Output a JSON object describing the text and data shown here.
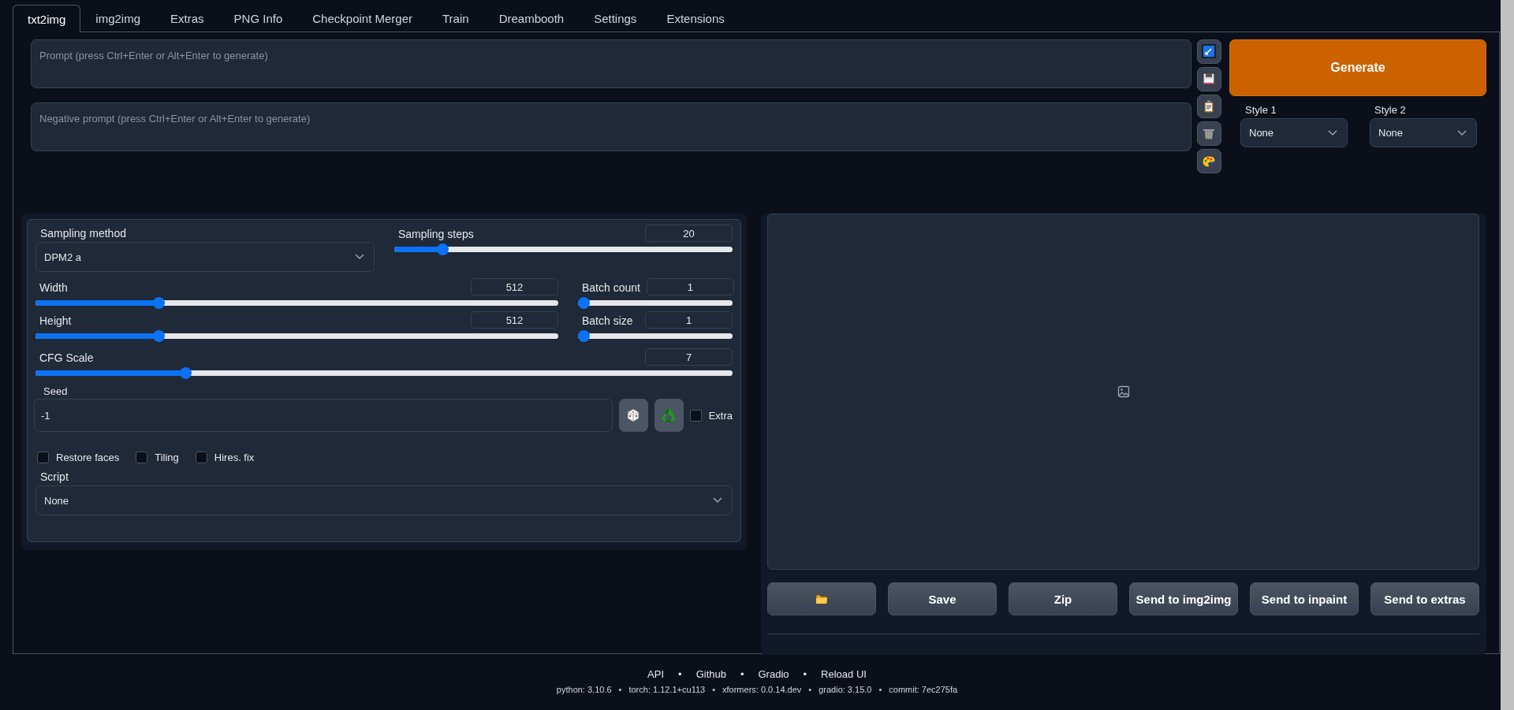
{
  "tabs": [
    {
      "label": "txt2img",
      "selected": true
    },
    {
      "label": "img2img",
      "selected": false
    },
    {
      "label": "Extras",
      "selected": false
    },
    {
      "label": "PNG Info",
      "selected": false
    },
    {
      "label": "Checkpoint Merger",
      "selected": false
    },
    {
      "label": "Train",
      "selected": false
    },
    {
      "label": "Dreambooth",
      "selected": false
    },
    {
      "label": "Settings",
      "selected": false
    },
    {
      "label": "Extensions",
      "selected": false
    }
  ],
  "prompt": {
    "placeholder": "Prompt (press Ctrl+Enter or Alt+Enter to generate)"
  },
  "negative_prompt": {
    "placeholder": "Negative prompt (press Ctrl+Enter or Alt+Enter to generate)"
  },
  "generate_button": "Generate",
  "styles": [
    {
      "label": "Style 1",
      "value": "None"
    },
    {
      "label": "Style 2",
      "value": "None"
    }
  ],
  "sampling_method": {
    "label": "Sampling method",
    "value": "DPM2 a"
  },
  "sampling_steps": {
    "label": "Sampling steps",
    "value": "20",
    "level": 0.13
  },
  "width": {
    "label": "Width",
    "value": "512",
    "level": 0.23
  },
  "batch_count": {
    "label": "Batch count",
    "value": "1",
    "level": 0
  },
  "height": {
    "label": "Height",
    "value": "512",
    "level": 0.23
  },
  "batch_size": {
    "label": "Batch size",
    "value": "1",
    "level": 0
  },
  "cfg_scale": {
    "label": "CFG Scale",
    "value": "7",
    "level": 0.21
  },
  "seed": {
    "label": "Seed",
    "value": "-1"
  },
  "extra": {
    "label": "Extra",
    "checked": false
  },
  "options": [
    {
      "label": "Restore faces",
      "checked": false
    },
    {
      "label": "Tiling",
      "checked": false
    },
    {
      "label": "Hires. fix",
      "checked": false
    }
  ],
  "script": {
    "label": "Script",
    "value": "None"
  },
  "output_buttons": [
    "Save",
    "Zip",
    "Send to img2img",
    "Send to inpaint",
    "Send to extras"
  ],
  "footer": {
    "separator": "•",
    "links": [
      "API",
      "Github",
      "Gradio",
      "Reload UI"
    ],
    "versions": [
      "python: 3.10.6",
      "torch: 1.12.1+cu113",
      "xformers: 0.0.14.dev",
      "gradio: 3.15.0",
      "commit: 7ec275fa"
    ]
  }
}
